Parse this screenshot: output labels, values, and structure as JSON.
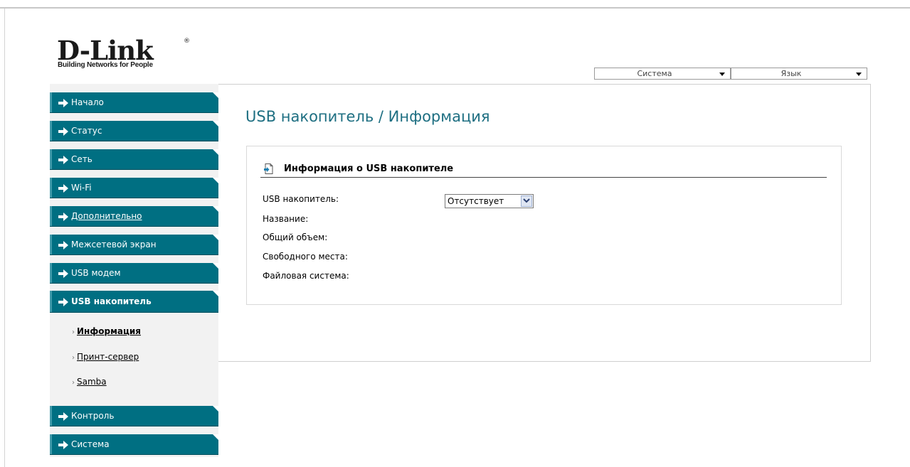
{
  "brand": {
    "name": "D-Link",
    "trademark": "®",
    "tagline": "Building Networks for People"
  },
  "header": {
    "system_select": "Система",
    "language_select": "Язык"
  },
  "sidebar": {
    "items": [
      {
        "label": "Начало"
      },
      {
        "label": "Статус"
      },
      {
        "label": "Сеть"
      },
      {
        "label": "Wi-Fi"
      },
      {
        "label": "Дополнительно"
      },
      {
        "label": "Межсетевой экран"
      },
      {
        "label": "USB модем"
      },
      {
        "label": "USB накопитель"
      },
      {
        "label": "Контроль"
      },
      {
        "label": "Система"
      }
    ],
    "subitems": [
      {
        "label": "Информация"
      },
      {
        "label": "Принт-сервер"
      },
      {
        "label": "Samba"
      }
    ],
    "bullet": "›"
  },
  "main": {
    "title": "USB накопитель / Информация",
    "section_title": "Информация о USB накопителе",
    "fields": [
      {
        "label": "USB накопитель:"
      },
      {
        "label": "Название:"
      },
      {
        "label": "Общий объем:"
      },
      {
        "label": "Свободного места:"
      },
      {
        "label": "Файловая система:"
      }
    ],
    "usb_select_value": "Отсутствует"
  },
  "colors": {
    "nav": "#006f82",
    "title": "#1e6f82"
  }
}
